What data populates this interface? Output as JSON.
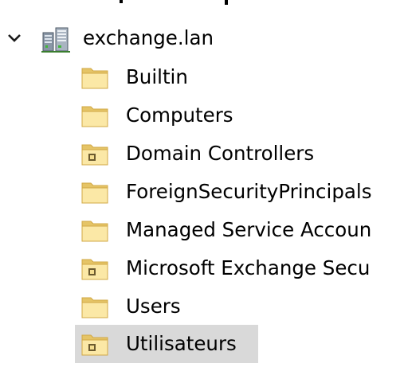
{
  "tree": {
    "top_partial_text": "...",
    "root": {
      "label": "exchange.lan",
      "expand_icon": "chevron-down-icon",
      "icon": "domain-icon"
    },
    "children": [
      {
        "label": "Builtin",
        "icon": "folder-icon",
        "selected": false
      },
      {
        "label": "Computers",
        "icon": "folder-icon",
        "selected": false
      },
      {
        "label": "Domain Controllers",
        "icon": "ou-folder-icon",
        "selected": false
      },
      {
        "label": "ForeignSecurityPrincipals",
        "icon": "folder-icon",
        "selected": false
      },
      {
        "label": "Managed Service Accoun",
        "icon": "folder-icon",
        "selected": false
      },
      {
        "label": "Microsoft Exchange Secu",
        "icon": "ou-folder-icon",
        "selected": false
      },
      {
        "label": "Users",
        "icon": "folder-icon",
        "selected": false
      },
      {
        "label": "Utilisateurs",
        "icon": "ou-folder-icon",
        "selected": true
      }
    ]
  },
  "colors": {
    "selection": "#d9d9d9",
    "folder_light": "#fbe8a6",
    "folder_dark": "#e5c466",
    "folder_edge": "#d1a845",
    "ou_badge": "#6b5a2f"
  }
}
